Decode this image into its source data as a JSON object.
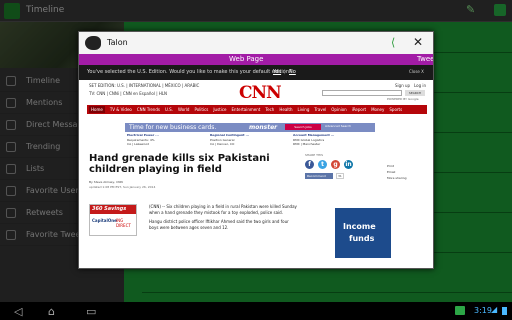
{
  "background_app": {
    "title": "Timeline",
    "sidebar_items": [
      {
        "label": "Timeline",
        "icon": "home-icon"
      },
      {
        "label": "Mentions",
        "icon": "at-icon"
      },
      {
        "label": "Direct Messages",
        "icon": "mail-icon"
      },
      {
        "label": "Trending",
        "icon": "trending-icon"
      },
      {
        "label": "Lists",
        "icon": "list-icon"
      },
      {
        "label": "Favorite Users",
        "icon": "star-icon"
      },
      {
        "label": "Retweets",
        "icon": "retweet-icon"
      },
      {
        "label": "Favorite Tweets",
        "icon": "heart-icon"
      }
    ],
    "accent_color": "#1ea53a"
  },
  "talon": {
    "title": "Talon",
    "tabs": {
      "webpage": "Web Page",
      "tweet": "Tweet"
    },
    "tab_color": "#a21ca6"
  },
  "cnn": {
    "edition_prompt": "You've selected the U.S. Edition. Would you like to make this your default edition?",
    "edition_yes": "Yes",
    "edition_sep": "|",
    "edition_no": "No",
    "edition_close": "Close X",
    "edition_row": "SET EDITION: U.S.  |  INTERNATIONAL  |  MÉXICO  |  ARABIC",
    "edition_row2": "TV:  CNN  |  CNNi  |  CNN en Español  |  HLN",
    "logo": "CNN",
    "signup": "Sign up",
    "login": "Log in",
    "search_button": "SEARCH",
    "powered_by": "POWERED BY Google",
    "nav_items": [
      "Home",
      "TV & Video",
      "CNN Trends",
      "U.S.",
      "World",
      "Politics",
      "Justice",
      "Entertainment",
      "Tech",
      "Health",
      "Living",
      "Travel",
      "Opinion",
      "iReport",
      "Money",
      "Sports"
    ],
    "ad_strip": {
      "text": "Time for new business cards.",
      "brand": "monster",
      "jobs_button": "Search Jobs",
      "advanced": "Advanced Search",
      "columns": [
        {
          "title": "Electrical Power ...",
          "line1": "Requirements: 4%",
          "line2": "CA | Lakewood"
        },
        {
          "title": "Regional Contingent ...",
          "line1": "Position General",
          "line2": "CA | Denver, CO"
        },
        {
          "title": "Account Management ...",
          "line1": "RMX Global Logistics",
          "line2": "RMX | Manchester"
        }
      ]
    },
    "headline": "Hand grenade kills six Pakistani children playing in field",
    "byline": "By Steve Almasy, CNN",
    "updated": "updated 1:08 PM EST, Sun January 26, 2014",
    "share_label": "SHARE THIS",
    "share_icons": [
      "facebook-icon",
      "twitter-icon",
      "google-plus-icon",
      "linkedin-icon"
    ],
    "recommend": "Recommend",
    "recommend_count": "31",
    "side_links": [
      "Print",
      "Email",
      "More sharing"
    ],
    "ad_capital": {
      "banner": "360 Savings",
      "brand": "CapitalOne",
      "tag": "ING DIRECT"
    },
    "article_p1": "(CNN) -- Six children playing in a field in rural Pakistan were killed Sunday when a hand grenade they mistook for a toy exploded, police said.",
    "article_p2": "Hangu district police officer Iftikhar Ahmed said the two girls and four boys were between ages seven and 12.",
    "ad_income": {
      "line1": "Income",
      "line2": "funds"
    }
  },
  "system": {
    "clock": "3:19"
  }
}
